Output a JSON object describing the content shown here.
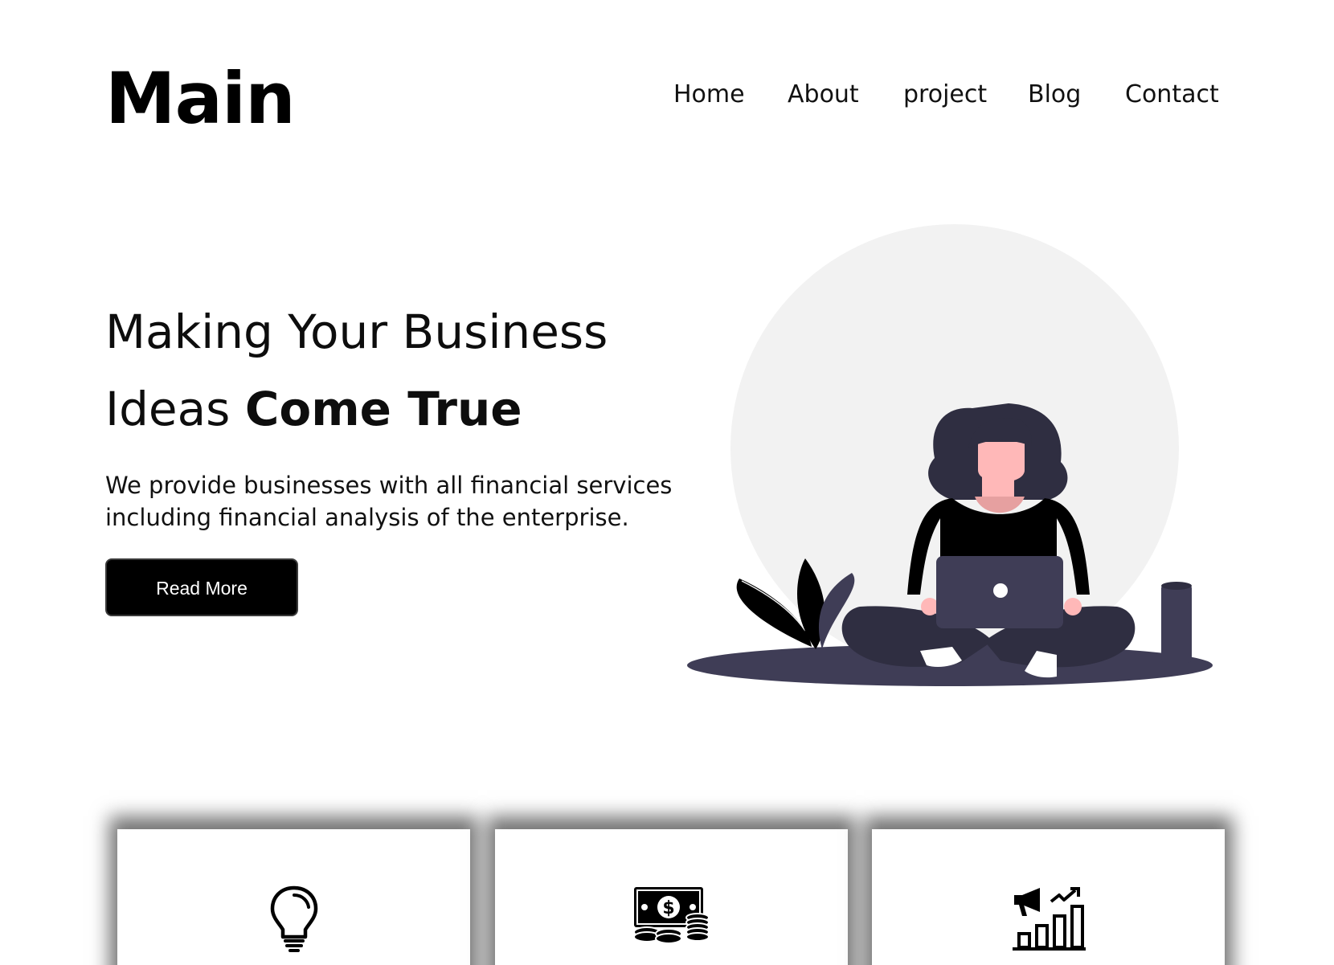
{
  "header": {
    "logo": "Main",
    "nav": [
      {
        "label": "Home"
      },
      {
        "label": "About"
      },
      {
        "label": "project"
      },
      {
        "label": "Blog"
      },
      {
        "label": "Contact"
      }
    ]
  },
  "hero": {
    "title_line1": "Making Your Business",
    "title_line2_regular": "Ideas ",
    "title_line2_bold": "Come True",
    "description_line1": "We provide businesses with all financial services",
    "description_line2": "including financial analysis of the enterprise.",
    "button_label": "Read More",
    "illustration": "woman-with-laptop-illustration"
  },
  "cards": [
    {
      "icon": "lightbulb-icon"
    },
    {
      "icon": "money-icon"
    },
    {
      "icon": "growth-chart-icon"
    }
  ],
  "colors": {
    "text": "#000000",
    "background": "#ffffff",
    "button": "#000000",
    "illustration_circle": "#f2f2f2",
    "illustration_dark": "#3f3d56",
    "skin": "#ffb8b8"
  }
}
